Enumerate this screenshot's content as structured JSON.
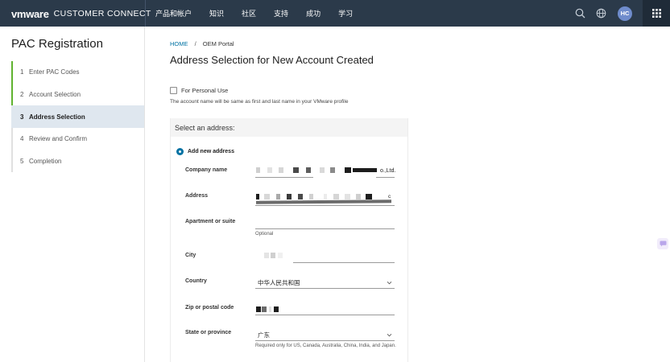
{
  "header": {
    "brand_logo": "vmware",
    "brand_product": "CUSTOMER CONNECT",
    "nav": [
      "产品和帐户",
      "知识",
      "社区",
      "支持",
      "成功",
      "学习"
    ],
    "icons": [
      "search-icon",
      "globe-icon",
      "avatar",
      "apps-grid-icon"
    ],
    "avatar_initials": "HC"
  },
  "sidebar": {
    "title": "PAC Registration",
    "steps": [
      {
        "num": "1",
        "label": "Enter PAC Codes",
        "state": "done"
      },
      {
        "num": "2",
        "label": "Account Selection",
        "state": "done"
      },
      {
        "num": "3",
        "label": "Address Selection",
        "state": "active"
      },
      {
        "num": "4",
        "label": "Review and Confirm",
        "state": "pending"
      },
      {
        "num": "5",
        "label": "Completion",
        "state": "pending"
      }
    ]
  },
  "main": {
    "breadcrumb": {
      "home": "HOME",
      "separator": "/",
      "current": "OEM Portal"
    },
    "title": "Address Selection for New Account Created",
    "personal_checkbox": {
      "label": "For Personal Use",
      "checked": false
    },
    "personal_note": "The account name will be same as first and last name in your VMware profile",
    "address_panel": {
      "header": "Select an address:",
      "radio_label": "Add new address",
      "fields": {
        "company": {
          "label": "Company name",
          "value_suffix": "o.,Ltd."
        },
        "address": {
          "label": "Address",
          "value_suffix": "c"
        },
        "apartment": {
          "label": "Apartment or suite",
          "hint": "Optional"
        },
        "city": {
          "label": "City"
        },
        "country": {
          "label": "Country",
          "value": "中华人民共和国"
        },
        "zip": {
          "label": "Zip or postal code"
        },
        "state": {
          "label": "State or province",
          "value": "广东",
          "hint": "Required only for US, Canada, Australia, China, India, and Japan."
        }
      }
    }
  },
  "colors": {
    "topbar": "#2b3a4a",
    "accent_link": "#0072a3",
    "step_done": "#60b330",
    "step_active_bg": "#dfe7ef",
    "avatar": "#6f8ccc"
  }
}
